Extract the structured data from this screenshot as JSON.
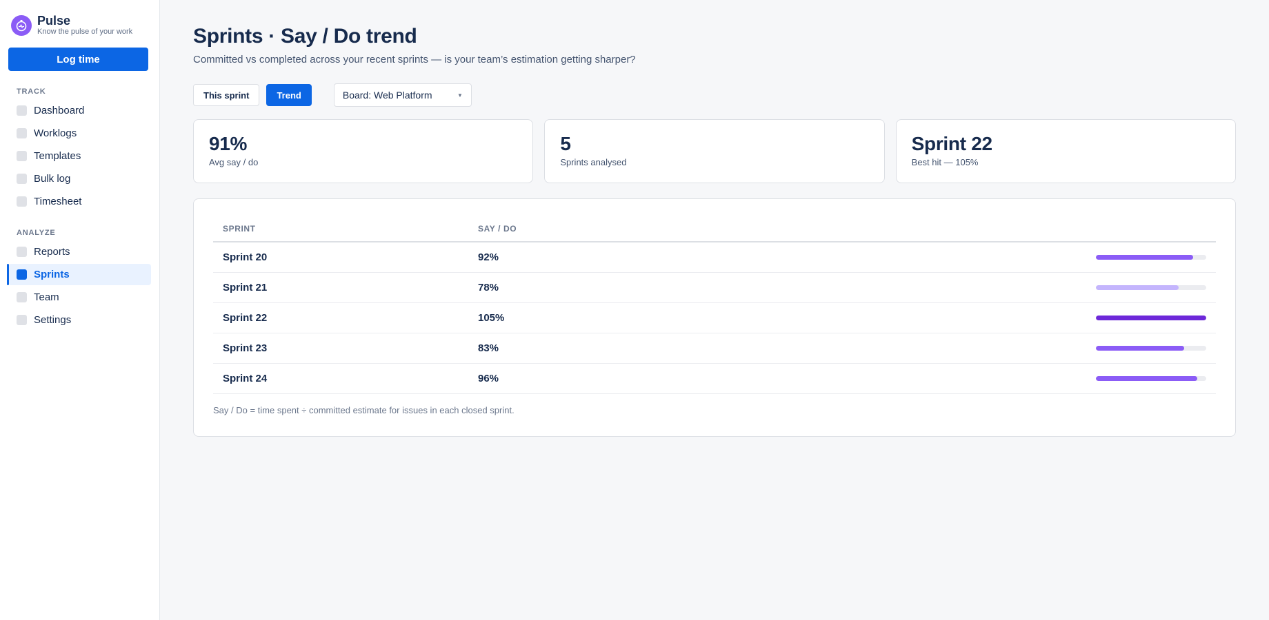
{
  "app": {
    "name": "Pulse",
    "tagline": "Know the pulse of your work"
  },
  "sidebar": {
    "log_button": "Log time",
    "sections": [
      {
        "title": "TRACK",
        "items": [
          "Dashboard",
          "Worklogs",
          "Templates",
          "Bulk log",
          "Timesheet"
        ]
      },
      {
        "title": "ANALYZE",
        "items": [
          "Reports",
          "Sprints",
          "Team",
          "Settings"
        ]
      }
    ],
    "active_item": "Sprints"
  },
  "page": {
    "title": "Sprints · Say / Do trend",
    "subtitle": "Committed vs completed across your recent sprints — is your team’s estimation getting sharper?"
  },
  "controls": {
    "this_sprint": "This sprint",
    "trend": "Trend",
    "board": "Board: Web Platform"
  },
  "stats": [
    {
      "value": "91%",
      "label": "Avg say / do"
    },
    {
      "value": "5",
      "label": "Sprints analysed"
    },
    {
      "value": "Sprint 22",
      "label": "Best hit — 105%"
    }
  ],
  "table": {
    "headers": [
      "SPRINT",
      "SAY / DO"
    ],
    "rows": [
      {
        "sprint": "Sprint 20",
        "say_do": "92%",
        "fill": 0.88,
        "color": "#8b5cf6"
      },
      {
        "sprint": "Sprint 21",
        "say_do": "78%",
        "fill": 0.75,
        "color": "#c4b5fd"
      },
      {
        "sprint": "Sprint 22",
        "say_do": "105%",
        "fill": 1.0,
        "color": "#6d28d9"
      },
      {
        "sprint": "Sprint 23",
        "say_do": "83%",
        "fill": 0.8,
        "color": "#8b5cf6"
      },
      {
        "sprint": "Sprint 24",
        "say_do": "96%",
        "fill": 0.92,
        "color": "#8b5cf6"
      }
    ],
    "footnote": "Say / Do = time spent ÷ committed estimate for issues in each closed sprint."
  }
}
